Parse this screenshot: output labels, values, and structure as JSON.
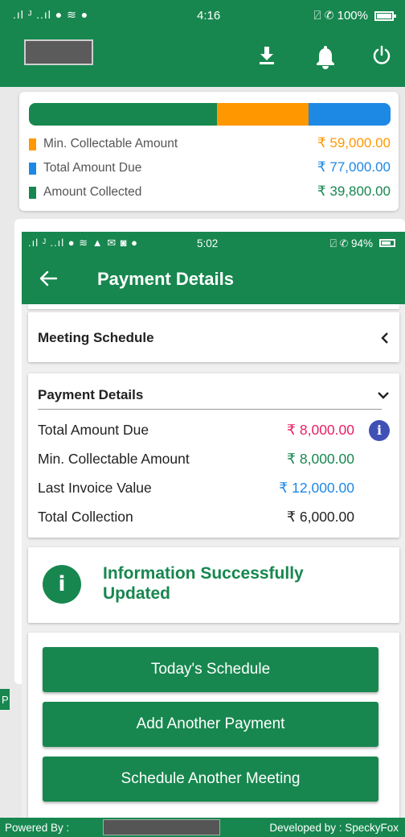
{
  "outer_status": {
    "signal": ".ıl ᴶ ..ıl ● ≋ ●",
    "time": "4:16",
    "right": "⍁ ✆ 100%"
  },
  "outer_appbar": {
    "icons": [
      "download-icon",
      "bell-icon",
      "power-icon"
    ]
  },
  "summary": {
    "bar": [
      {
        "name": "Amount Collected",
        "fraction": 0.52,
        "color": "#17874f"
      },
      {
        "name": "Min. Collectable Amount",
        "fraction": 0.254,
        "color": "#ff9800"
      },
      {
        "name": "Total Amount Due",
        "fraction": 0.226,
        "color": "#1e88e5"
      }
    ],
    "legend": [
      {
        "label": "Min. Collectable Amount",
        "value": "₹ 59,000.00",
        "color": "#ff9800"
      },
      {
        "label": "Total Amount Due",
        "value": "₹ 77,000.00",
        "color": "#1e88e5"
      },
      {
        "label": "Amount Collected",
        "value": "₹ 39,800.00",
        "color": "#17874f"
      }
    ]
  },
  "outer_footer_peek": {
    "left": "P",
    "right": "x"
  },
  "inner_status": {
    "signal": ".ıl ᴶ ..ıl ● ≋ ▲ ✉ ◙ ●",
    "time": "5:02",
    "right": "⍁ ✆ 94%"
  },
  "inner_appbar": {
    "title": "Payment Details"
  },
  "meeting": {
    "heading": "Meeting Schedule"
  },
  "payment": {
    "heading": "Payment Details",
    "rows": [
      {
        "label": "Total Amount Due",
        "value": "₹ 8,000.00",
        "color": "#e91e63"
      },
      {
        "label": "Min. Collectable Amount",
        "value": "₹ 8,000.00",
        "color": "#17874f"
      },
      {
        "label": "Last Invoice Value",
        "value": "₹ 12,000.00",
        "color": "#1e88e5"
      },
      {
        "label": "Total Collection",
        "value": "₹ 6,000.00",
        "color": "#222222"
      }
    ]
  },
  "message": {
    "text": "Information Successfully Updated"
  },
  "buttons": {
    "todays_schedule": "Today's Schedule",
    "add_payment": "Add Another Payment",
    "schedule_meeting": "Schedule Another Meeting"
  },
  "footer": {
    "powered_by": "Powered By :",
    "developed_by": "Developed by : SpeckyFox"
  },
  "colors": {
    "primary": "#17874f",
    "info_blue": "#3f51b5"
  }
}
